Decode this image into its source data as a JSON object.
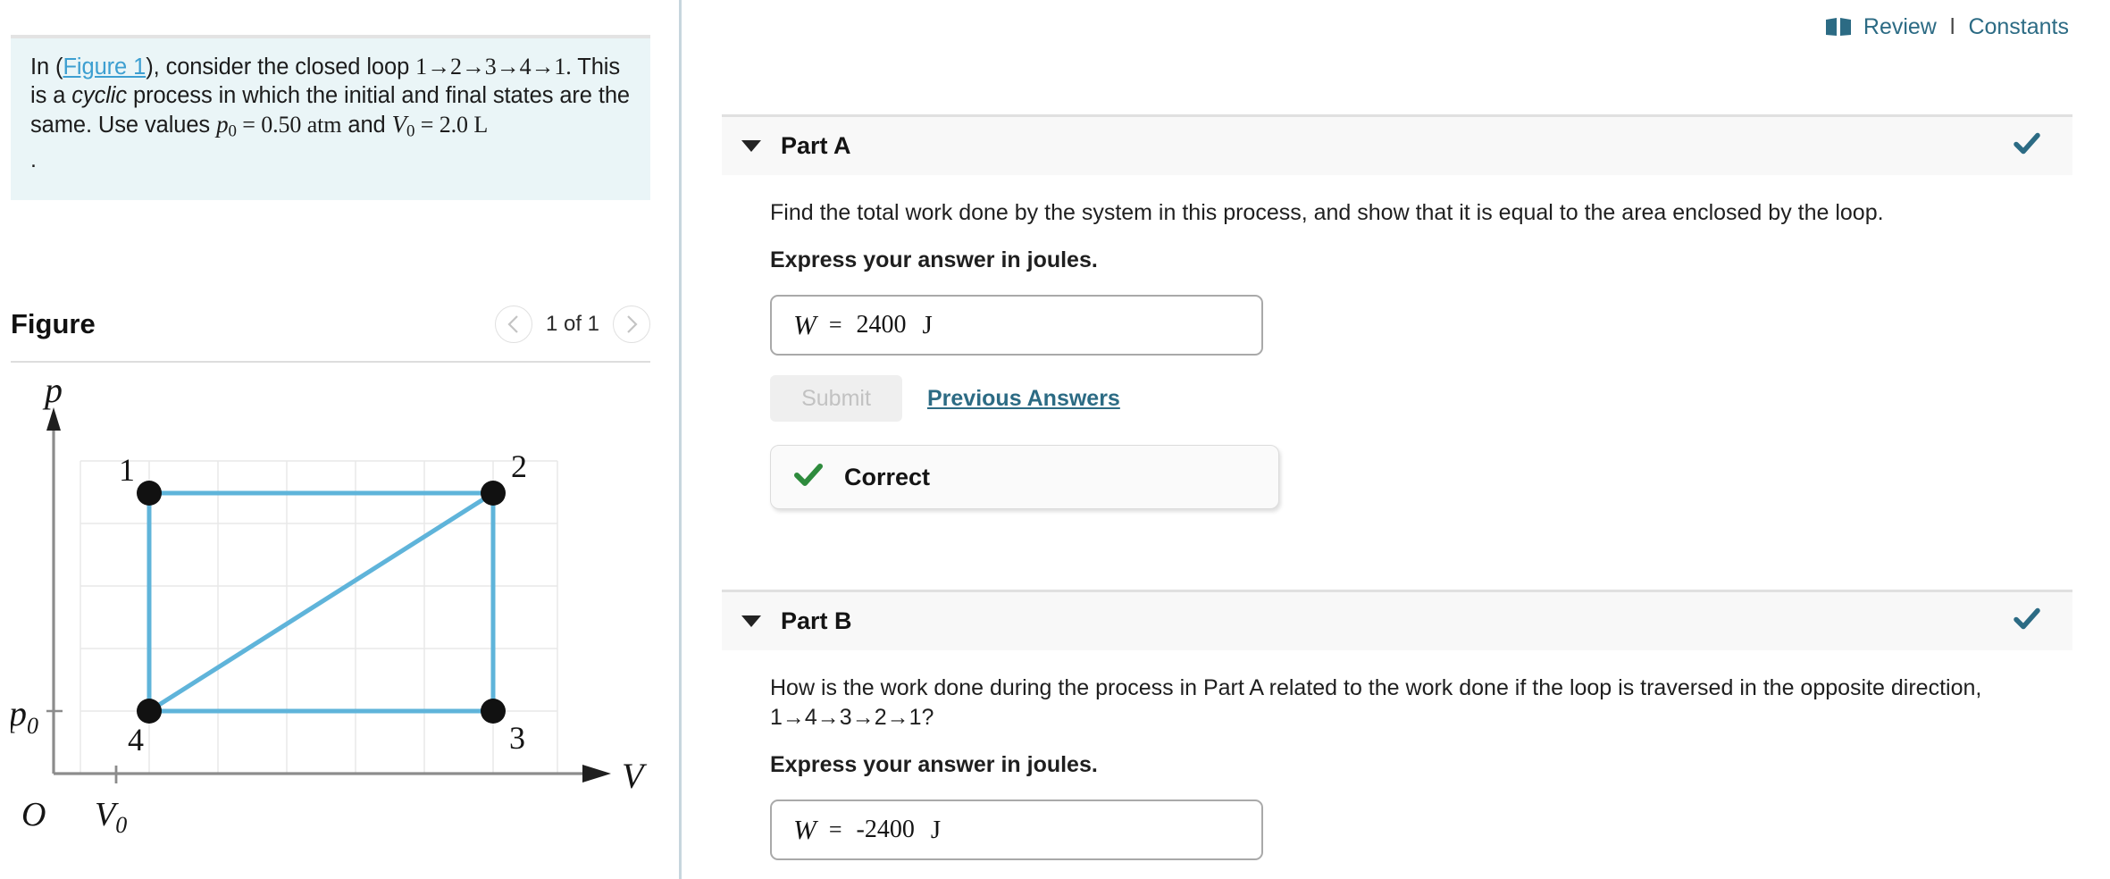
{
  "problem": {
    "intro_prefix": "In (",
    "figure_link": "Figure 1",
    "intro_mid": "), consider the closed loop ",
    "loop_sequence": "1→2→3→4→1.",
    "sentence2_a": "This is a ",
    "cyclic_word": "cyclic",
    "sentence2_b": " process in which the initial and final states are the same. Use values ",
    "p0_symbol": "p",
    "p0_sub": "0",
    "p0_value": " = 0.50 atm",
    "and_word": " and ",
    "v0_symbol": "V",
    "v0_sub": "0",
    "v0_value": " = 2.0 L",
    "trailing_dot": "."
  },
  "figure": {
    "title": "Figure",
    "counter": "1 of 1",
    "prev_icon": "chevron-left-icon",
    "next_icon": "chevron-right-icon"
  },
  "chart_data": {
    "type": "line",
    "title": "pV diagram of closed loop 1-2-3-4-1",
    "xlabel": "V",
    "ylabel": "p",
    "origin_label": "O",
    "x_tick_labels": [
      "V₀"
    ],
    "y_tick_labels": [
      "p₀"
    ],
    "grid": true,
    "points": [
      {
        "label": "1",
        "x": 1,
        "y": 3,
        "label_pos": "top-left"
      },
      {
        "label": "2",
        "x": 4,
        "y": 3,
        "label_pos": "top-right"
      },
      {
        "label": "3",
        "x": 4,
        "y": 1,
        "label_pos": "bottom-right"
      },
      {
        "label": "4",
        "x": 1,
        "y": 1,
        "label_pos": "bottom-left"
      }
    ],
    "segments": [
      {
        "from": "1",
        "to": "2"
      },
      {
        "from": "2",
        "to": "3"
      },
      {
        "from": "3",
        "to": "4"
      },
      {
        "from": "4",
        "to": "1"
      },
      {
        "from": "4",
        "to": "2"
      }
    ],
    "line_color": "#5fb4da",
    "point_color": "#111111",
    "xlim": [
      0,
      5
    ],
    "ylim": [
      0,
      4
    ]
  },
  "header": {
    "book_icon": "book-icon",
    "review_label": "Review",
    "separator": "l",
    "constants_label": "Constants",
    "accent_color": "#2c6b84"
  },
  "parts": [
    {
      "label": "Part A",
      "status_icon": "check-icon",
      "question": "Find the total work done by the system in this process, and show that it is equal to the area enclosed by the loop.",
      "express": "Express your answer in joules.",
      "answer": {
        "variable": "W",
        "equals": "=",
        "value": "2400",
        "unit": "J"
      },
      "submit_label": "Submit",
      "previous_answers_label": "Previous Answers",
      "feedback": {
        "icon": "green-check-icon",
        "label": "Correct",
        "color": "#2e8b3d"
      }
    },
    {
      "label": "Part B",
      "status_icon": "check-icon",
      "question": "How is the work done during the process in Part A related to the work done if the loop is traversed in the opposite direction, 1→4→3→2→1?",
      "express": "Express your answer in joules.",
      "answer": {
        "variable": "W",
        "equals": "=",
        "value": "-2400",
        "unit": "J"
      }
    }
  ]
}
